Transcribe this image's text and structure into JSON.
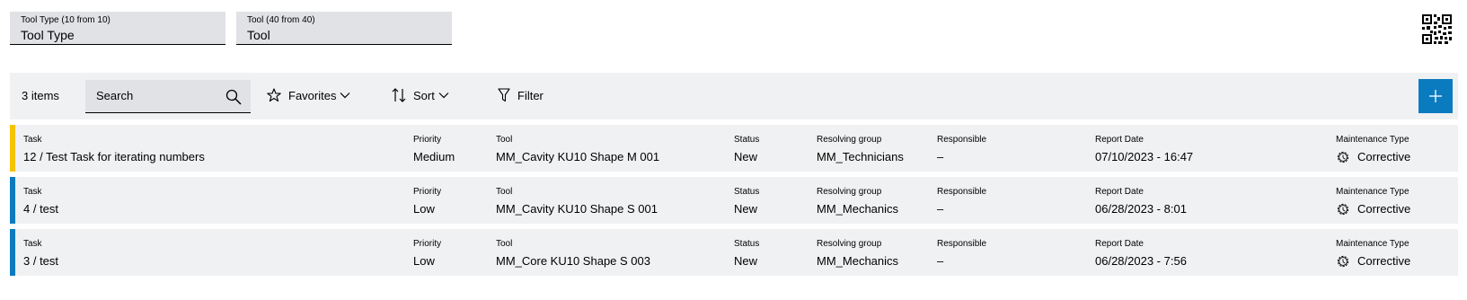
{
  "filters": [
    {
      "label": "Tool Type (10 from 10)",
      "value": "Tool Type"
    },
    {
      "label": "Tool (40 from 40)",
      "value": "Tool"
    }
  ],
  "toolbar": {
    "count": "3 items",
    "search_placeholder": "Search",
    "favorites": "Favorites",
    "sort": "Sort",
    "filter": "Filter"
  },
  "headers": {
    "task": "Task",
    "priority": "Priority",
    "tool": "Tool",
    "status": "Status",
    "group": "Resolving group",
    "responsible": "Responsible",
    "date": "Report Date",
    "mtype": "Maintenance Type"
  },
  "rows": [
    {
      "accent": "#f5c400",
      "task": "12 / Test Task for iterating numbers",
      "priority": "Medium",
      "tool": "MM_Cavity KU10 Shape M 001",
      "status": "New",
      "group": "MM_Technicians",
      "responsible": "–",
      "date": "07/10/2023 - 16:47",
      "mtype": "Corrective"
    },
    {
      "accent": "#0b7bc0",
      "task": "4 / test",
      "priority": "Low",
      "tool": "MM_Cavity KU10 Shape S 001",
      "status": "New",
      "group": "MM_Mechanics",
      "responsible": "–",
      "date": "06/28/2023 - 8:01",
      "mtype": "Corrective"
    },
    {
      "accent": "#0b7bc0",
      "task": "3 / test",
      "priority": "Low",
      "tool": "MM_Core KU10 Shape S 003",
      "status": "New",
      "group": "MM_Mechanics",
      "responsible": "–",
      "date": "06/28/2023 - 7:56",
      "mtype": "Corrective"
    }
  ],
  "colors": {
    "accent": "#0b7bc0",
    "panel": "#eff1f2",
    "field": "#e0e2e5"
  },
  "icons": [
    "qr-code-icon",
    "search-icon",
    "star-icon",
    "chevron-down-icon",
    "sort-icon",
    "filter-icon",
    "plus-icon",
    "gear-icon"
  ]
}
